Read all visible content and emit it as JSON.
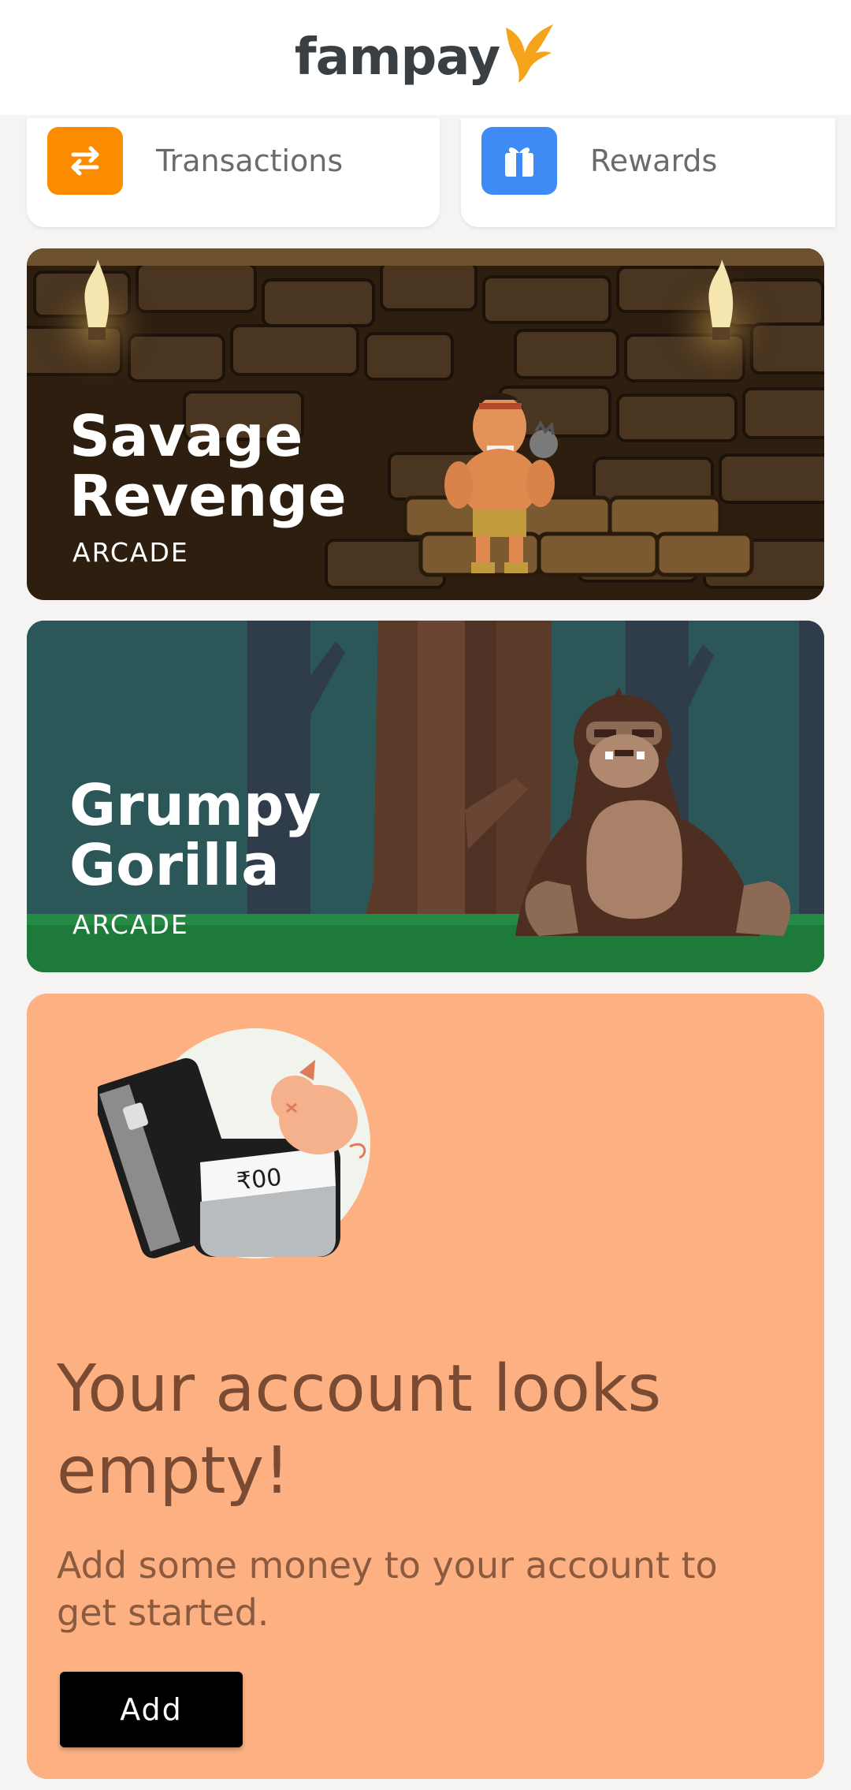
{
  "header": {
    "logo_text": "fampay"
  },
  "quick_actions": [
    {
      "label": "Transactions",
      "icon": "swap-arrows-icon",
      "color": "#fb8c00"
    },
    {
      "label": "Rewards",
      "icon": "gift-icon",
      "color": "#3e8bf5"
    }
  ],
  "games": [
    {
      "title_line1": "Savage",
      "title_line2": "Revenge",
      "category": "ARCADE"
    },
    {
      "title_line1": "Grumpy",
      "title_line2": "Gorilla",
      "category": "ARCADE"
    }
  ],
  "empty_account": {
    "title": "Your account looks empty!",
    "subtitle": "Add some money to your account to get started.",
    "card_amount": "₹00",
    "button_label": "Add"
  },
  "colors": {
    "accent": "#f5a31a",
    "empty_card_bg": "#fdb182"
  }
}
